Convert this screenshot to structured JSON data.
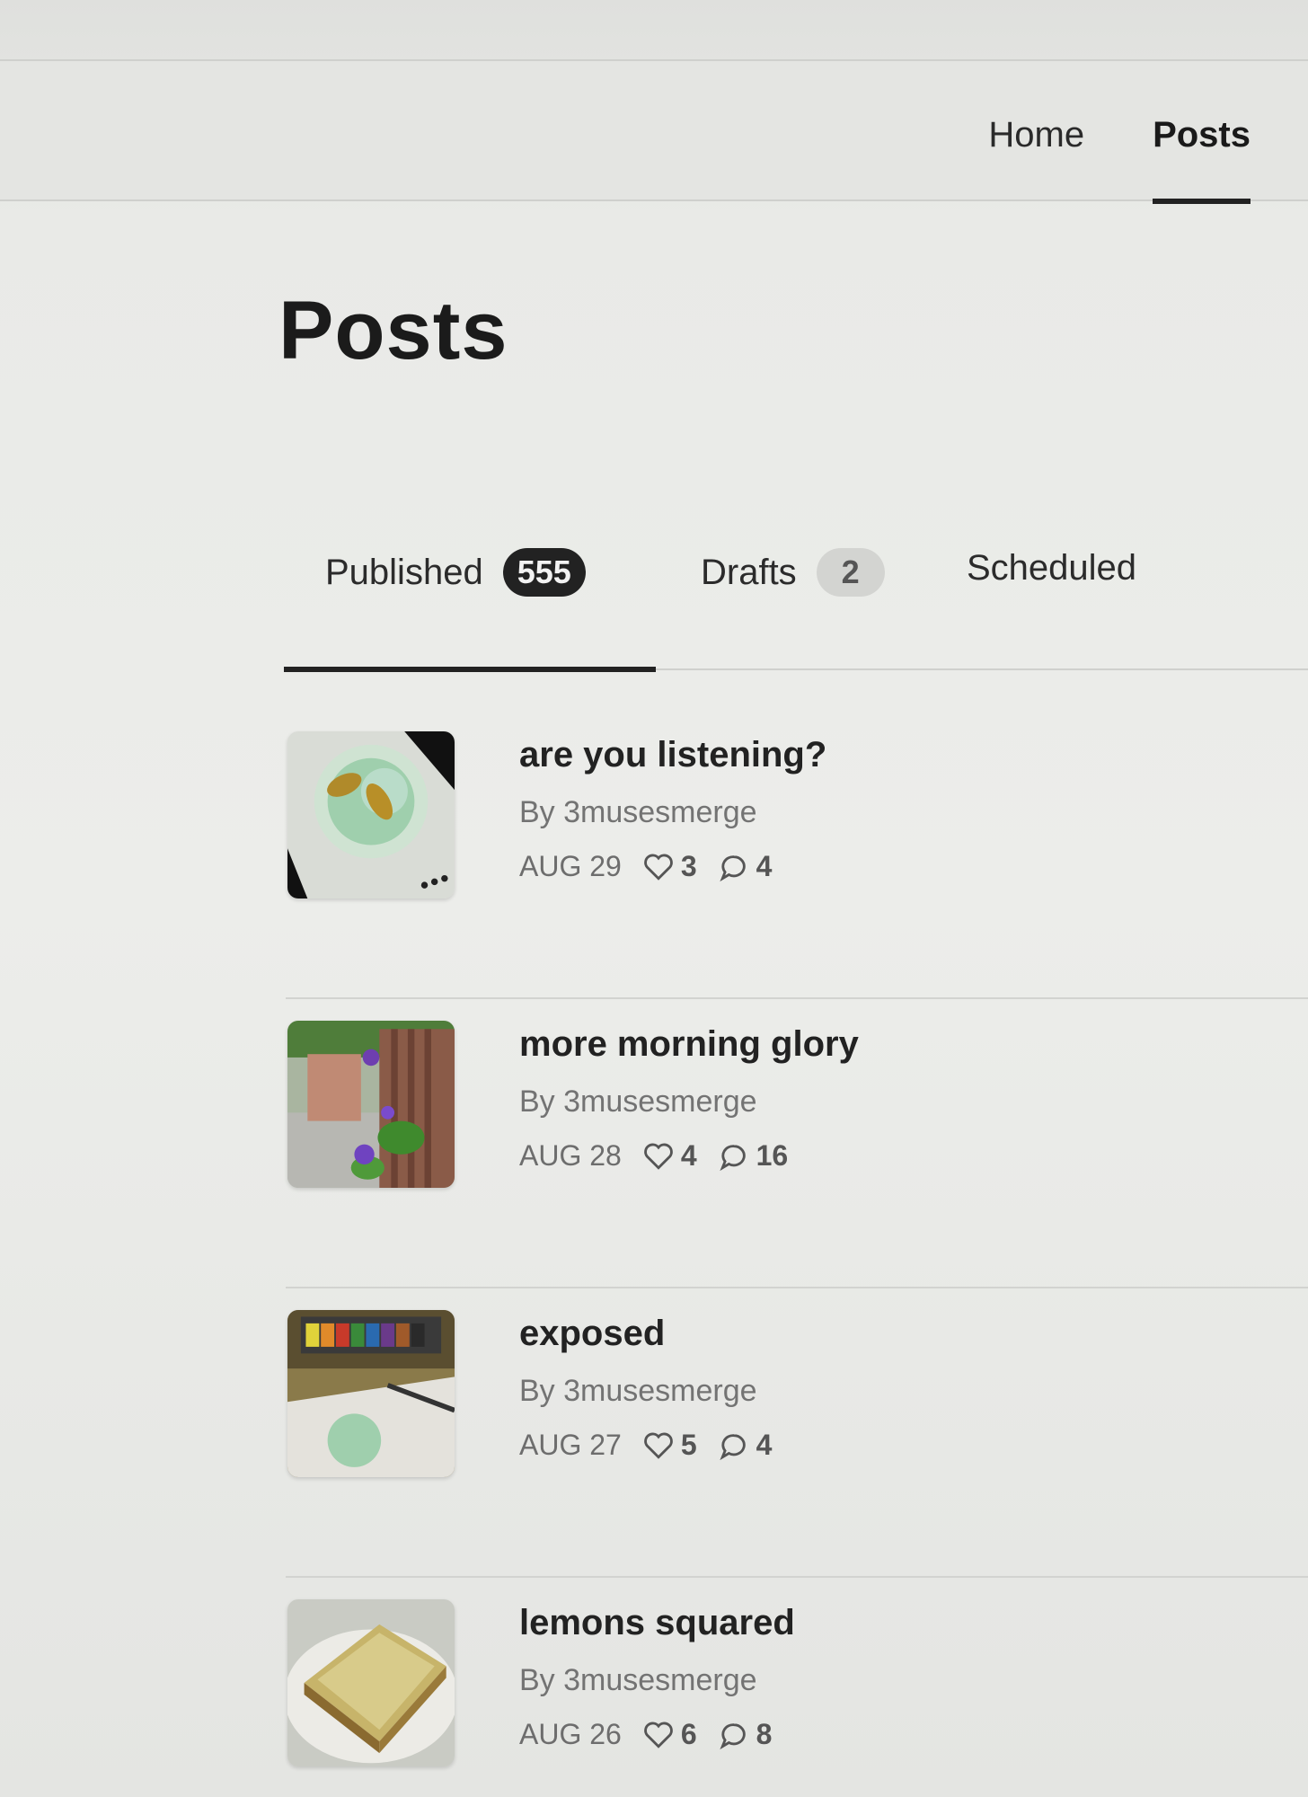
{
  "nav": {
    "items": [
      {
        "label": "Home",
        "active": false
      },
      {
        "label": "Posts",
        "active": true
      }
    ]
  },
  "page": {
    "title": "Posts"
  },
  "tabs": {
    "published": {
      "label": "Published",
      "count": "555"
    },
    "drafts": {
      "label": "Drafts",
      "count": "2"
    },
    "scheduled": {
      "label": "Scheduled"
    }
  },
  "posts": [
    {
      "title": "are you listening?",
      "author": "By 3musesmerge",
      "date": "AUG 29",
      "likes": "3",
      "comments": "4",
      "thumbnail": "watercolor-fish-painting"
    },
    {
      "title": "more morning glory",
      "author": "By 3musesmerge",
      "date": "AUG 28",
      "likes": "4",
      "comments": "16",
      "thumbnail": "morning-glory-fence"
    },
    {
      "title": "exposed",
      "author": "By 3musesmerge",
      "date": "AUG 27",
      "likes": "5",
      "comments": "4",
      "thumbnail": "watercolor-palette"
    },
    {
      "title": "lemons squared",
      "author": "By 3musesmerge",
      "date": "AUG 26",
      "likes": "6",
      "comments": "8",
      "thumbnail": "lemon-square-dessert"
    }
  ],
  "icons": {
    "like": "heart-icon",
    "comment": "comment-icon"
  },
  "colors": {
    "accent": "#222222",
    "badge_dark": "#222222",
    "badge_light": "#d3d4d1"
  }
}
